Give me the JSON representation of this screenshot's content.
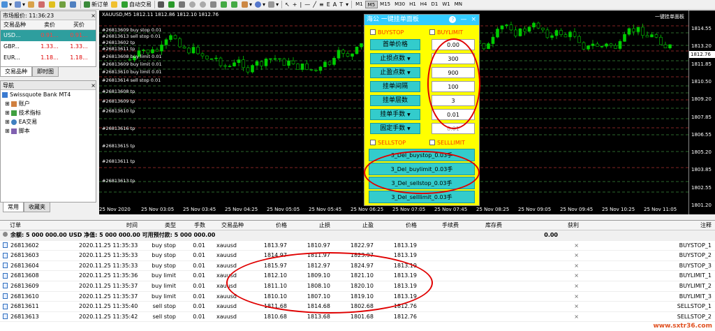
{
  "toolbar": {
    "new_order": "新订单",
    "auto_trading": "自动交易",
    "timeframes": [
      "M1",
      "M5",
      "M15",
      "M30",
      "H1",
      "H4",
      "D1",
      "W1",
      "MN"
    ]
  },
  "market_watch": {
    "title": "市场报价: 11:36:23",
    "headers": [
      "交易品种",
      "卖价",
      "买价"
    ],
    "rows": [
      {
        "symbol": "USD...",
        "bid": "0.91...",
        "ask": "0.91..."
      },
      {
        "symbol": "GBP...",
        "bid": "1.33...",
        "ask": "1.33..."
      },
      {
        "symbol": "EUR...",
        "bid": "1.18...",
        "ask": "1.18..."
      }
    ],
    "tabs": [
      "交易品种",
      "即时图"
    ]
  },
  "navigator": {
    "title": "导航",
    "items": [
      "Swissquote Bank MT4",
      "账户",
      "技术指标",
      "EA交易",
      "脚本"
    ],
    "tabs": [
      "常用",
      "收藏夹"
    ]
  },
  "chart": {
    "header": "XAUUSD,M5  1812.11 1812.86 1812.10 1812.76",
    "right_label": "一键挂单面板",
    "price_ticks": [
      "1814.55",
      "1813.20",
      "1811.85",
      "1810.50",
      "1809.20",
      "1807.85",
      "1806.55",
      "1805.20",
      "1803.85",
      "1802.55",
      "1801.20"
    ],
    "current_price": "1812.76",
    "time_ticks": [
      "25 Nov 2020",
      "25 Nov 03:05",
      "25 Nov 03:45",
      "25 Nov 04:25",
      "25 Nov 05:05",
      "25 Nov 05:45",
      "25 Nov 06:25",
      "25 Nov 07:05",
      "25 Nov 07:45",
      "25 Nov 08:25",
      "25 Nov 09:05",
      "25 Nov 09:45",
      "25 Nov 10:25",
      "25 Nov 11:05"
    ],
    "order_lines": [
      "#26813609 buy stop 0.01",
      "#26813613 sell stop 0.01",
      "#26813602 tp",
      "#26813611 tp",
      "#26813608 buy limit 0.01",
      "#26813609 buy limit 0.01",
      "#26813610 buy limit 0.01",
      "#26813614 sell stop 0.01",
      "#26813608 tp",
      "#26813609 tp",
      "#26813610 tp",
      "#26813616 tp",
      "#26813615 tp",
      "#26813611 tp",
      "#26813613 tp"
    ]
  },
  "ea_panel": {
    "title": "海公 一键挂单面板",
    "help": "?",
    "buystop": "BUYSTOP",
    "buylimit": "BUYLIMIT",
    "sellstop": "SELLSTOP",
    "selllimit": "SELLLIMIT",
    "rows": [
      {
        "label": "首单价格",
        "value": "0.00"
      },
      {
        "label": "止损点数",
        "value": "300"
      },
      {
        "label": "止盈点数",
        "value": "900"
      },
      {
        "label": "挂单间隔",
        "value": "100"
      },
      {
        "label": "挂单层数",
        "value": "3"
      },
      {
        "label": "挂单手数",
        "value": "0.01"
      },
      {
        "label": "固定手数",
        "value": "0.01"
      }
    ],
    "delete_buttons": [
      "3_Del_buystop_0.03手",
      "3_Del_buylimit_0.03手",
      "3_Del_sellstop_0.03手",
      "3_Del_selllimit_0.03手"
    ]
  },
  "terminal": {
    "headers": [
      "订单",
      "时间",
      "类型",
      "手数",
      "交易品种",
      "价格",
      "止损",
      "止盈",
      "价格",
      "手续费",
      "库存费",
      "获利",
      "注释"
    ],
    "balance_line": "余额: 5 000 000.00 USD  净值: 5 000 000.00  可用预付款: 5 000 000.00",
    "balance_profit": "0.00",
    "orders": [
      {
        "id": "26813602",
        "time": "2020.11.25 11:35:33",
        "type": "buy stop",
        "lots": "0.01",
        "symbol": "xauusd",
        "price": "1813.97",
        "sl": "1810.97",
        "tp": "1822.97",
        "cur": "1813.19",
        "comment": "BUYSTOP_1"
      },
      {
        "id": "26813603",
        "time": "2020.11.25 11:35:33",
        "type": "buy stop",
        "lots": "0.01",
        "symbol": "xauusd",
        "price": "1814.97",
        "sl": "1811.97",
        "tp": "1823.97",
        "cur": "1813.19",
        "comment": "BUYSTOP_2"
      },
      {
        "id": "26813604",
        "time": "2020.11.25 11:35:33",
        "type": "buy stop",
        "lots": "0.01",
        "symbol": "xauusd",
        "price": "1815.97",
        "sl": "1812.97",
        "tp": "1824.97",
        "cur": "1813.19",
        "comment": "BUYSTOP_3"
      },
      {
        "id": "26813608",
        "time": "2020.11.25 11:35:36",
        "type": "buy limit",
        "lots": "0.01",
        "symbol": "xauusd",
        "price": "1812.10",
        "sl": "1809.10",
        "tp": "1821.10",
        "cur": "1813.19",
        "comment": "BUYLIMIT_1"
      },
      {
        "id": "26813609",
        "time": "2020.11.25 11:35:37",
        "type": "buy limit",
        "lots": "0.01",
        "symbol": "xauusd",
        "price": "1811.10",
        "sl": "1808.10",
        "tp": "1820.10",
        "cur": "1813.19",
        "comment": "BUYLIMIT_2"
      },
      {
        "id": "26813610",
        "time": "2020.11.25 11:35:37",
        "type": "buy limit",
        "lots": "0.01",
        "symbol": "xauusd",
        "price": "1810.10",
        "sl": "1807.10",
        "tp": "1819.10",
        "cur": "1813.19",
        "comment": "BUYLIMIT_3"
      },
      {
        "id": "26813611",
        "time": "2020.11.25 11:35:40",
        "type": "sell stop",
        "lots": "0.01",
        "symbol": "xauusd",
        "price": "1811.68",
        "sl": "1814.68",
        "tp": "1802.68",
        "cur": "1812.76",
        "comment": "SELLSTOP_1"
      },
      {
        "id": "26813613",
        "time": "2020.11.25 11:35:42",
        "type": "sell stop",
        "lots": "0.01",
        "symbol": "xauusd",
        "price": "1810.68",
        "sl": "1813.68",
        "tp": "1801.68",
        "cur": "1812.76",
        "comment": "SELLSTOP_2"
      }
    ]
  },
  "watermark": "www.sxtr36.com",
  "colors": {
    "chart_bg": "#000000",
    "bull": "#00cc00",
    "bear": "#000000",
    "ea_bg": "#ffff00",
    "ea_btn": "#33cccc",
    "annotation": "#e00000"
  }
}
